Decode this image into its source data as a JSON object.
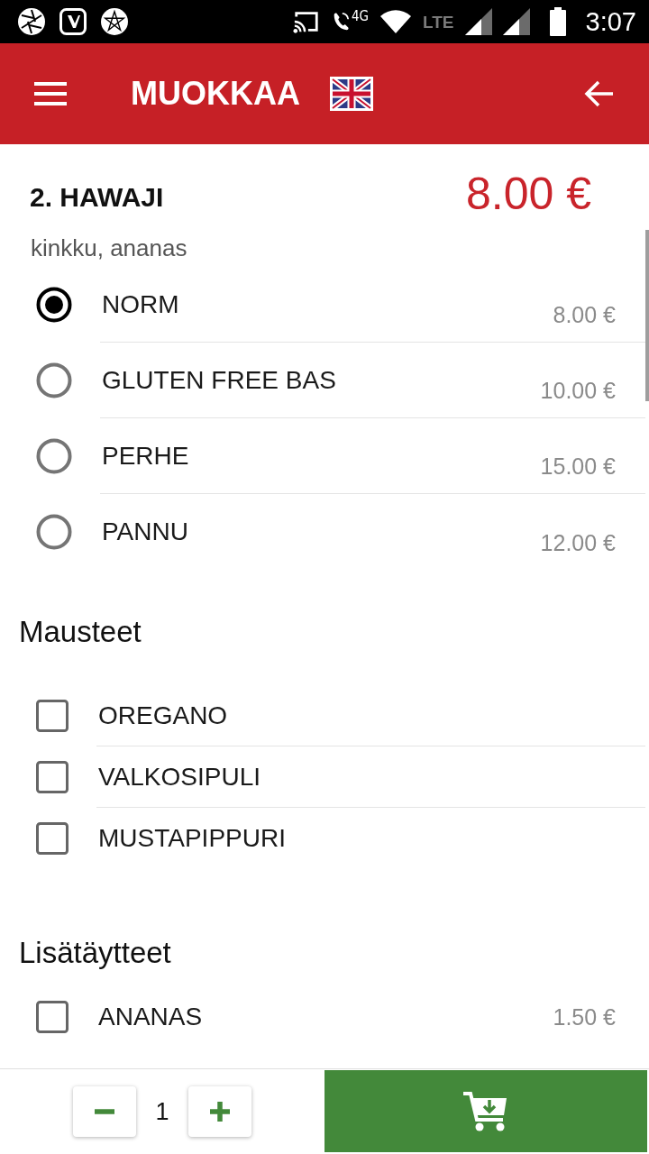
{
  "status_bar": {
    "network_label": "4G",
    "lte_label": "LTE",
    "time": "3:07"
  },
  "app_bar": {
    "title": "MUOKKAA"
  },
  "product": {
    "name": "2. HAWAJI",
    "price": "8.00 €",
    "description": "kinkku, ananas"
  },
  "sizes": [
    {
      "label": "NORM",
      "price": "8.00 €",
      "selected": true
    },
    {
      "label": "GLUTEN FREE BAS",
      "price": "10.00 €",
      "selected": false
    },
    {
      "label": "PERHE",
      "price": "15.00 €",
      "selected": false
    },
    {
      "label": "PANNU",
      "price": "12.00 €",
      "selected": false
    }
  ],
  "sections": [
    {
      "title": "Mausteet",
      "options": [
        {
          "label": "OREGANO",
          "checked": false
        },
        {
          "label": "VALKOSIPULI",
          "checked": false
        },
        {
          "label": "MUSTAPIPPURI",
          "checked": false
        }
      ]
    },
    {
      "title": "Lisätäytteet",
      "options": [
        {
          "label": "ANANAS",
          "price": "1.50 €",
          "checked": false
        }
      ]
    }
  ],
  "footer": {
    "quantity": "1"
  }
}
